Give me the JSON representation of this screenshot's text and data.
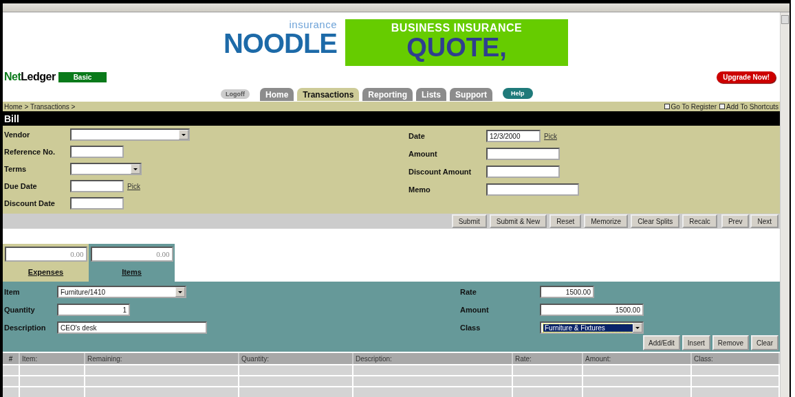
{
  "ad_banner": {
    "logo_tagline": "insurance",
    "logo": "NOODLE",
    "headline": "BUSINESS INSURANCE",
    "subline": "QUOTE,"
  },
  "brand": {
    "name_first": "Net",
    "name_second": "Ledger",
    "edition": "Basic"
  },
  "upgrade_button": "Upgrade Now!",
  "nav": {
    "logoff": "Logoff",
    "help": "Help",
    "tabs": [
      {
        "label": "Home",
        "selected": false
      },
      {
        "label": "Transactions",
        "selected": true
      },
      {
        "label": "Reporting",
        "selected": false
      },
      {
        "label": "Lists",
        "selected": false
      },
      {
        "label": "Support",
        "selected": false
      }
    ]
  },
  "breadcrumb": "Home > Transactions >",
  "shortcuts": [
    "Go To Register",
    "Add To Shortcuts"
  ],
  "form_title": "Bill",
  "fields_left": [
    {
      "label": "Vendor",
      "kind": "select"
    },
    {
      "label": "Reference No.",
      "kind": "text"
    },
    {
      "label": "Terms",
      "kind": "select"
    },
    {
      "label": "Due Date",
      "kind": "text",
      "pick": "Pick"
    },
    {
      "label": "Discount Date",
      "kind": "text"
    }
  ],
  "fields_right": [
    {
      "label": "Date",
      "kind": "text",
      "value": "12/3/2000",
      "pick": "Pick"
    },
    {
      "label": "Amount",
      "kind": "text"
    },
    {
      "label": "Discount Amount",
      "kind": "text"
    },
    {
      "label": "Memo",
      "kind": "text"
    }
  ],
  "actions": [
    "Submit",
    "Submit & New",
    "Reset",
    "Memorize",
    "Clear Splits",
    "Recalc"
  ],
  "paging": [
    "Prev",
    "Next"
  ],
  "subtabs": [
    {
      "label": "Expenses",
      "total": "0.00",
      "selected": false
    },
    {
      "label": "Items",
      "total": "0.00",
      "selected": true
    }
  ],
  "item_fields_left": [
    {
      "label": "Item",
      "kind": "select",
      "value": "Furniture/1410",
      "focused": false
    },
    {
      "label": "Quantity",
      "kind": "number",
      "value": "1"
    },
    {
      "label": "Description",
      "kind": "text",
      "value": "CEO's desk"
    }
  ],
  "item_fields_right": [
    {
      "label": "Rate",
      "kind": "number",
      "value": "1500.00"
    },
    {
      "label": "Amount",
      "kind": "number",
      "value": "1500.00"
    },
    {
      "label": "Class",
      "kind": "select",
      "value": "Furniture & Fixtures",
      "focused": true
    }
  ],
  "line_buttons": [
    "Add/Edit",
    "Insert",
    "Remove",
    "Clear"
  ],
  "table": {
    "columns": [
      "#",
      "Item:",
      "Remaining:",
      "Quantity:",
      "Description:",
      "Rate:",
      "Amount:",
      "Class:"
    ]
  }
}
